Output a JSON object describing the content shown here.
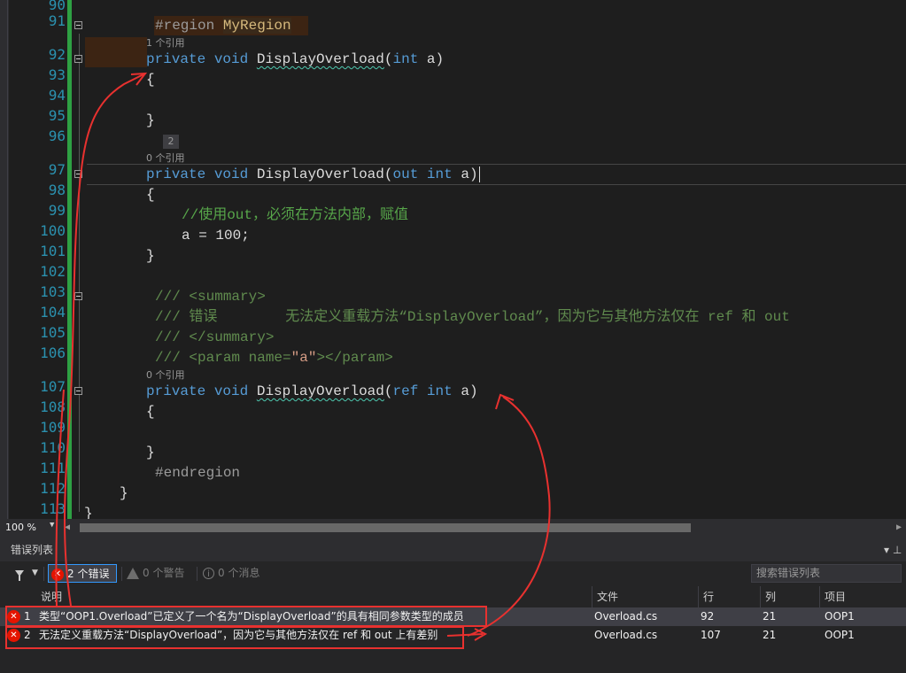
{
  "editor": {
    "lines": [
      {
        "n": "90"
      },
      {
        "n": "91"
      },
      {
        "n": "92"
      },
      {
        "n": "93"
      },
      {
        "n": "94"
      },
      {
        "n": "95"
      },
      {
        "n": "96"
      },
      {
        "n": "97"
      },
      {
        "n": "98"
      },
      {
        "n": "99"
      },
      {
        "n": "100"
      },
      {
        "n": "101"
      },
      {
        "n": "102"
      },
      {
        "n": "103"
      },
      {
        "n": "104"
      },
      {
        "n": "105"
      },
      {
        "n": "106"
      },
      {
        "n": "107"
      },
      {
        "n": "108"
      },
      {
        "n": "109"
      },
      {
        "n": "110"
      },
      {
        "n": "111"
      },
      {
        "n": "112"
      },
      {
        "n": "113"
      }
    ],
    "code": {
      "region_kw": "#region ",
      "region_name": "MyRegion",
      "lens1": "1 个引用",
      "lens2": "0 个引用",
      "lens3": "0 个引用",
      "private": "private",
      "void": "void",
      "method": "DisplayOverload",
      "int": "int",
      "out": "out",
      "ref": "ref",
      "param_a": "a",
      "open_paren": "(",
      "close_paren": ")",
      "brace_open": "{",
      "brace_close": "}",
      "comment99": "//使用out，必须在方法内部，赋值",
      "assign100": "a = 100;",
      "doc103": "/// <summary>",
      "doc104": "/// 错误        无法定义重载方法“DisplayOverload”，因为它与其他方法仅在 ref 和 out",
      "doc105": "/// </summary>",
      "doc106_pre": "/// <param name=",
      "doc106_val": "\"a\"",
      "doc106_post": "></param>",
      "endregion": "#endregion",
      "badge": "2"
    }
  },
  "scrollbar": {
    "zoom": "100 %"
  },
  "error_list": {
    "title": "错误列表",
    "pin": "▾ ⊥",
    "errors_button": "2 个错误",
    "warnings_button": "0 个警告",
    "messages_button": "0 个消息",
    "search_placeholder": "搜索错误列表",
    "columns": {
      "desc": "说明",
      "file": "文件",
      "line": "行",
      "col": "列",
      "project": "项目"
    },
    "rows": [
      {
        "num": "1",
        "desc": "类型“OOP1.Overload”已定义了一个名为“DisplayOverload”的具有相同参数类型的成员",
        "file": "Overload.cs",
        "line": "92",
        "col": "21",
        "project": "OOP1"
      },
      {
        "num": "2",
        "desc": "无法定义重载方法“DisplayOverload”，因为它与其他方法仅在 ref 和 out 上有差别",
        "file": "Overload.cs",
        "line": "107",
        "col": "21",
        "project": "OOP1"
      }
    ]
  },
  "colors": {
    "editor_bg": "#1e1e1e",
    "keyword": "#569cd6",
    "comment": "#57a64a",
    "line_number": "#2b91af",
    "error_red": "#e51400",
    "annotation_red": "#e8312f"
  }
}
